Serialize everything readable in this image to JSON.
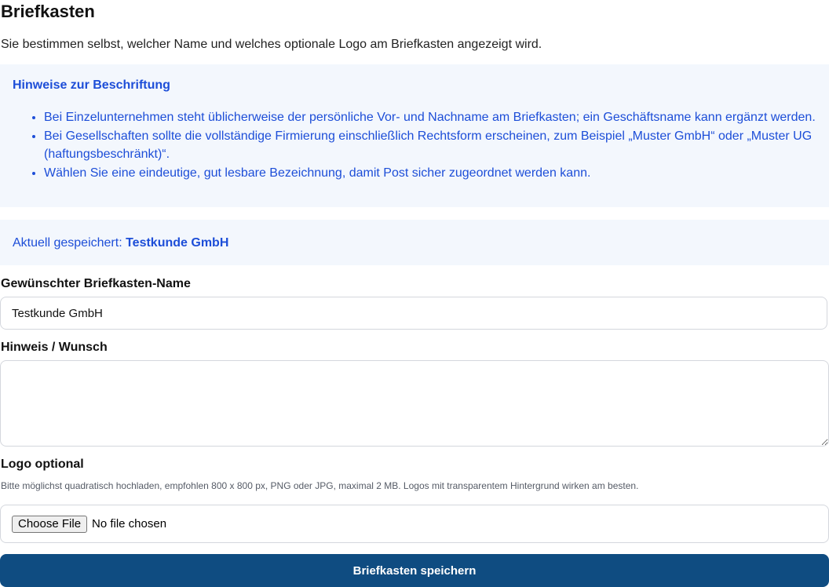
{
  "page": {
    "title": "Briefkasten",
    "intro": "Sie bestimmen selbst, welcher Name und welches optionale Logo am Briefkasten angezeigt wird."
  },
  "hints": {
    "title": "Hinweise zur Beschriftung",
    "items": [
      "Bei Einzelunternehmen steht üblicherweise der persönliche Vor- und Nachname am Briefkasten; ein Geschäftsname kann ergänzt werden.",
      "Bei Gesellschaften sollte die vollständige Firmierung einschließlich Rechtsform erscheinen, zum Beispiel „Muster GmbH“ oder „Muster UG (haftungsbeschränkt)“.",
      "Wählen Sie eine eindeutige, gut lesbare Bezeichnung, damit Post sicher zugeordnet werden kann."
    ]
  },
  "saved": {
    "label": "Aktuell gespeichert:",
    "value": "Testkunde GmbH"
  },
  "form": {
    "name_label": "Gewünschter Briefkasten-Name",
    "name_value": "Testkunde GmbH",
    "note_label": "Hinweis / Wunsch",
    "note_value": "",
    "logo_label": "Logo optional",
    "logo_help": "Bitte möglichst quadratisch hochladen, empfohlen 800 x 800 px, PNG oder JPG, maximal 2 MB. Logos mit transparentem Hintergrund wirken am besten.",
    "file_button": "Choose File",
    "file_status": "No file chosen",
    "submit_label": "Briefkasten speichern"
  },
  "colors": {
    "accent": "#1d4ed8",
    "hint_background": "#f3f7fd",
    "primary_button": "#0f4c81"
  }
}
